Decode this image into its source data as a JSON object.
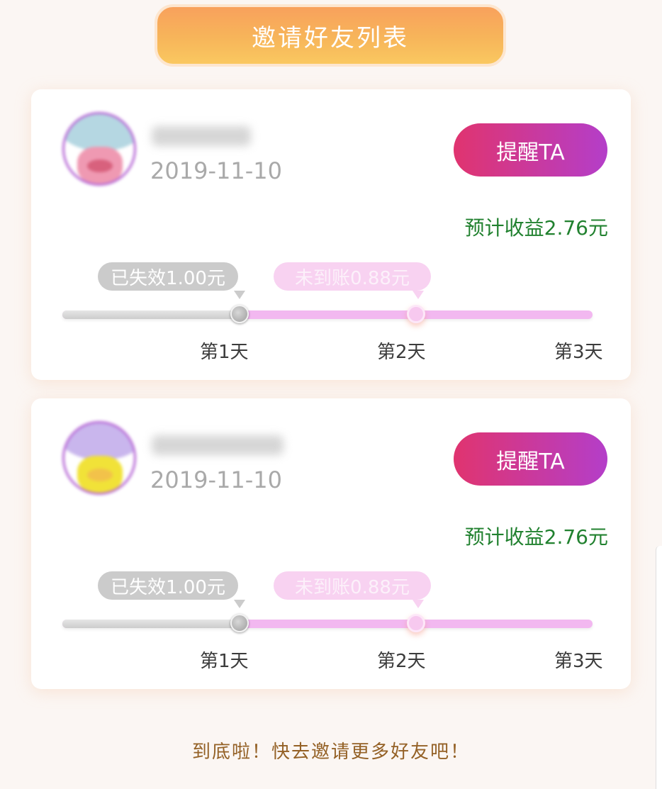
{
  "header": {
    "title": "邀请好友列表"
  },
  "invites": [
    {
      "avatar_colors": {
        "top": "#b5d7e2",
        "face": "#ef99b2",
        "mouth": "#d8617d"
      },
      "name_hidden": true,
      "date": "2019-11-10",
      "remind_label": "提醒TA",
      "estimated_earnings": "预计收益2.76元",
      "expired_tag": "已失效1.00元",
      "pending_tag": "未到账0.88元",
      "progress_days": 2,
      "days": [
        "第1天",
        "第2天",
        "第3天"
      ]
    },
    {
      "avatar_colors": {
        "top": "#c9b6ed",
        "face": "#f1e238",
        "mouth": "#f2c24a"
      },
      "name_hidden": true,
      "date": "2019-11-10",
      "remind_label": "提醒TA",
      "estimated_earnings": "预计收益2.76元",
      "expired_tag": "已失效1.00元",
      "pending_tag": "未到账0.88元",
      "progress_days": 2,
      "days": [
        "第1天",
        "第2天",
        "第3天"
      ]
    }
  ],
  "footer": {
    "text": "到底啦！快去邀请更多好友吧！"
  }
}
